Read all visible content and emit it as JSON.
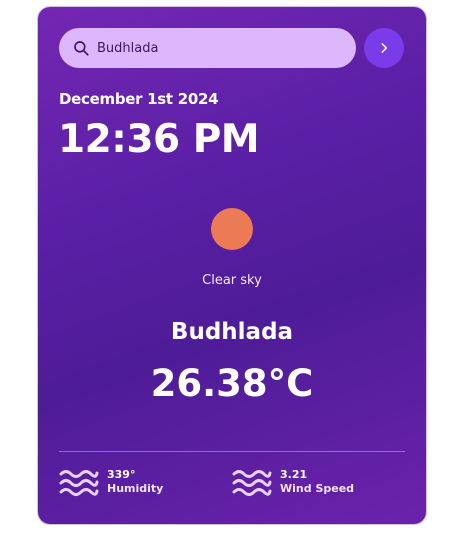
{
  "search": {
    "value": "Budhlada"
  },
  "date": "December 1st 2024",
  "time": "12:36 PM",
  "weather": {
    "icon": "sun-icon",
    "condition": "Clear sky",
    "city": "Budhlada",
    "temperature": "26.38°C"
  },
  "stats": [
    {
      "icon": "waves-icon",
      "value": "339°",
      "label": "Humidity"
    },
    {
      "icon": "waves-icon",
      "value": "3.21",
      "label": "Wind Speed"
    }
  ],
  "colors": {
    "card_gradient_start": "#7427b2",
    "card_gradient_end": "#4e1c98",
    "search_background": "#dcb7fb",
    "button_background": "#7a3ce8",
    "sun": "#ec7a55",
    "text": "#ffffff"
  }
}
